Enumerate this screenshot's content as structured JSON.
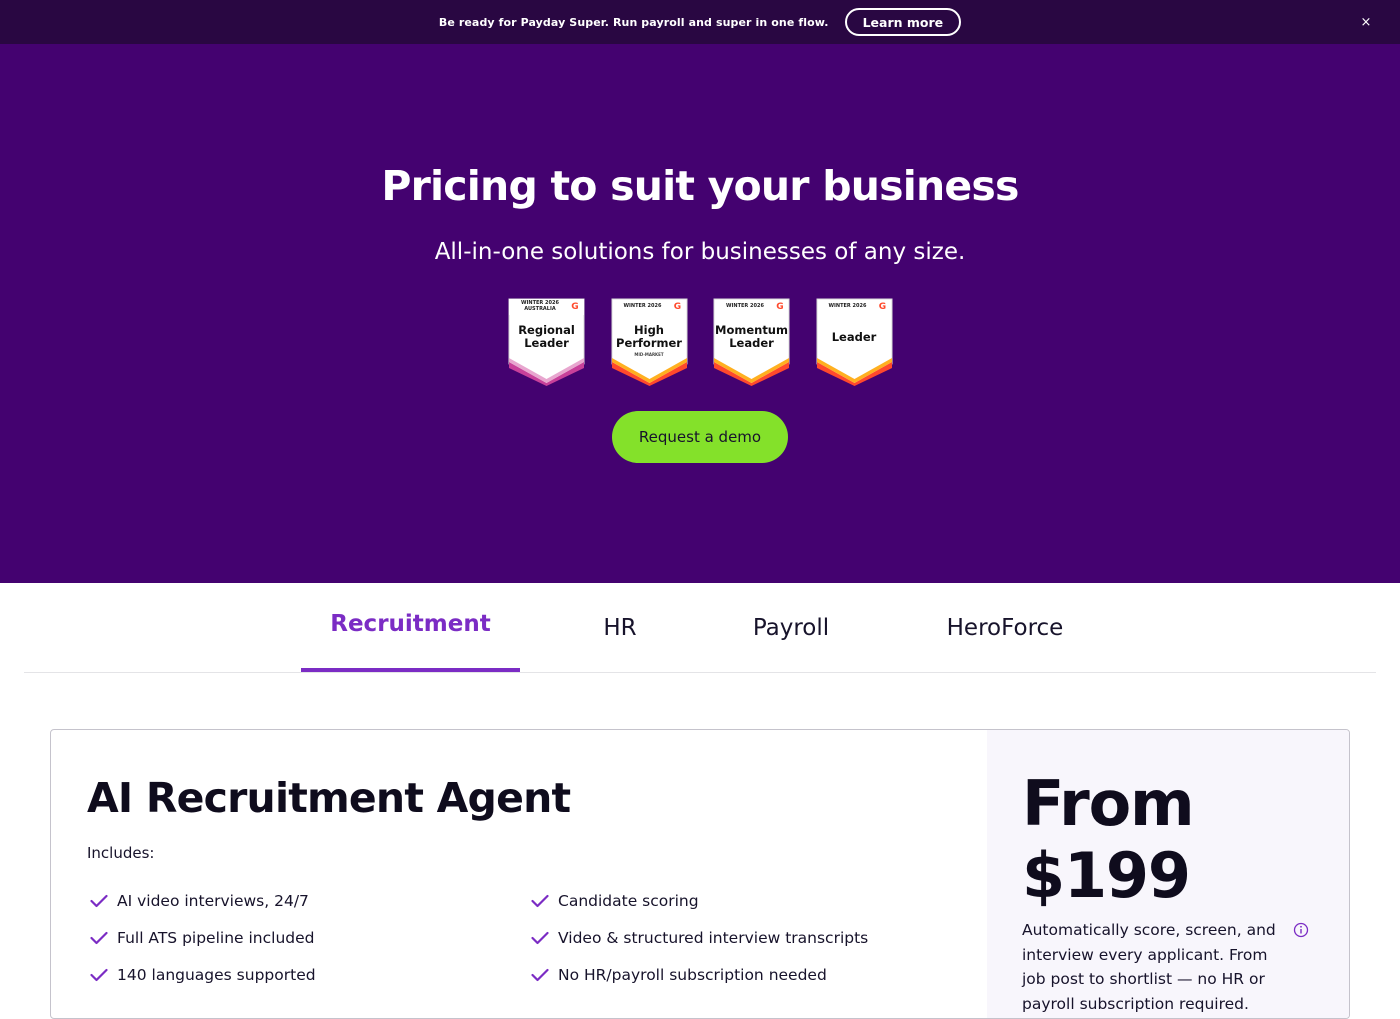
{
  "banner": {
    "text": "Be ready for Payday Super. Run payroll and super in one flow.",
    "learn_more": "Learn more",
    "close": "×"
  },
  "hero": {
    "title": "Pricing to suit your business",
    "subtitle": "All-in-one solutions for businesses of any size.",
    "badges": [
      {
        "season": "WINTER 2026",
        "region": "AUSTRALIA",
        "line1": "Regional",
        "line2": "Leader",
        "mini": "",
        "g": "G"
      },
      {
        "season": "WINTER 2026",
        "region": "",
        "line1": "High",
        "line2": "Performer",
        "mini": "MID-MARKET",
        "g": "G"
      },
      {
        "season": "WINTER 2026",
        "region": "",
        "line1": "Momentum",
        "line2": "Leader",
        "mini": "",
        "g": "G"
      },
      {
        "season": "WINTER 2026",
        "region": "",
        "line1": "Leader",
        "line2": "",
        "mini": "",
        "g": "G"
      }
    ],
    "demo_button": "Request a demo"
  },
  "tabs": [
    {
      "label": "Recruitment",
      "active": true
    },
    {
      "label": "HR",
      "active": false
    },
    {
      "label": "Payroll",
      "active": false
    },
    {
      "label": "HeroForce",
      "active": false
    }
  ],
  "plan": {
    "title": "AI Recruitment Agent",
    "includes_label": "Includes:",
    "features_left": [
      "AI video interviews, 24/7",
      "Full ATS pipeline included",
      "140 languages supported"
    ],
    "features_right": [
      "Candidate scoring",
      "Video & structured interview transcripts",
      "No HR/payroll subscription needed"
    ],
    "price_line1": "From",
    "price_line2": "$199",
    "description": "Automatically score, screen, and interview every applicant. From job post to shortlist — no HR or payroll subscription required."
  },
  "colors": {
    "banner_bg": "#290742",
    "hero_bg": "#440270",
    "accent_purple": "#7b2cc4",
    "demo_green": "#84e12a"
  },
  "icons": {
    "close": "close-icon",
    "check": "check-icon",
    "info": "info-icon",
    "g2": "g2-logo-icon"
  }
}
